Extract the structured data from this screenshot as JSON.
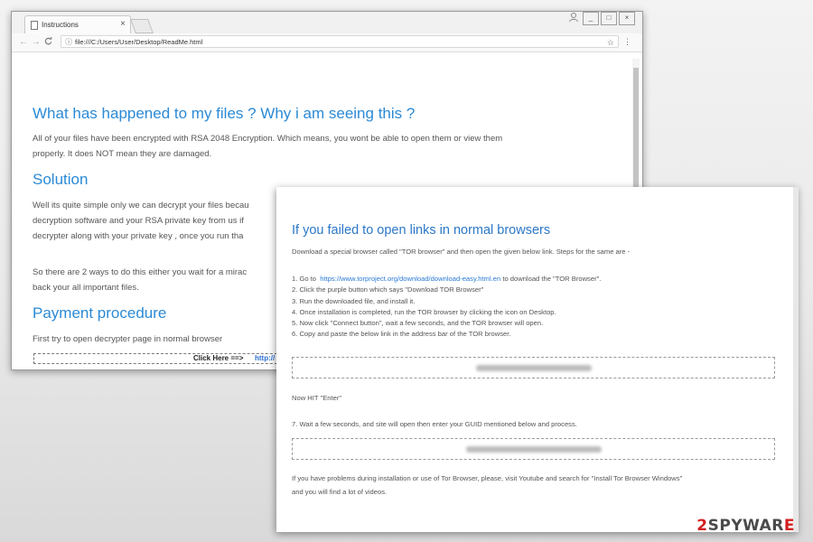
{
  "browser": {
    "tab_title": "Instructions",
    "tab_close": "×",
    "url": "file:///C:/Users/User/Desktop/ReadMe.html",
    "nav_back": "←",
    "nav_forward": "→",
    "reload": "C",
    "info_icon": "ⓘ",
    "star_icon": "☆",
    "menu_icon": "⋮",
    "window_buttons": [
      "_",
      "□",
      "×"
    ]
  },
  "ransom_page": {
    "heading1": "What has happened to my files ? Why i am seeing this ?",
    "para1_line1": "All of your files have been encrypted with RSA 2048 Encryption. Which means, you wont be able to open them or view them",
    "para1_line2": "properly.   It does NOT mean they are damaged.",
    "heading2": "Solution",
    "para2_line1": "Well its quite simple only we can decrypt your files becau",
    "para2_line2": "decryption software and your RSA private key from us if",
    "para2_line3": "decrypter along with your private key , once you run tha",
    "para3_line1": "So there are 2 ways to do this either you wait for a mirac",
    "para3_line2": "back your all important files.",
    "heading3": "Payment procedure",
    "para4": "First try to open decrypter page in normal browser",
    "click_here": "Click Here ==>",
    "click_link": "http://"
  },
  "tor_page": {
    "heading": "If you failed to open links in normal browsers",
    "intro": "Download a special browser called \"TOR browser\" and then open the given below link. Steps for the same are -",
    "step1_prefix": "1. Go to",
    "step1_link": "https://www.torproject.org/download/download-easy.html.en",
    "step1_suffix": "to download the \"TOR Browser\".",
    "step2": "2. Click the purple button which says \"Download TOR Browser\"",
    "step3": "3. Run the downloaded file, and install it.",
    "step4": "4. Once installation is completed, run the TOR browser by clicking the icon on Desktop.",
    "step5": "5. Now click \"Connect button\", wait a few seconds, and the TOR browser will open.",
    "step6": "6. Copy and paste the below link in the address bar of the TOR browser.",
    "hit_enter": "Now HIT \"Enter\"",
    "step7": "7. Wait a few seconds, and site will open then enter your GUID mentioned below and process.",
    "problems_line1": "If you have problems during installation or use of Tor Browser, please, visit Youtube and search for \"Install Tor Browser Windows\"",
    "problems_line2": "and you will find a lot of videos."
  },
  "watermark": {
    "digit": "2",
    "text": "SPYWAR",
    "end": "E"
  }
}
